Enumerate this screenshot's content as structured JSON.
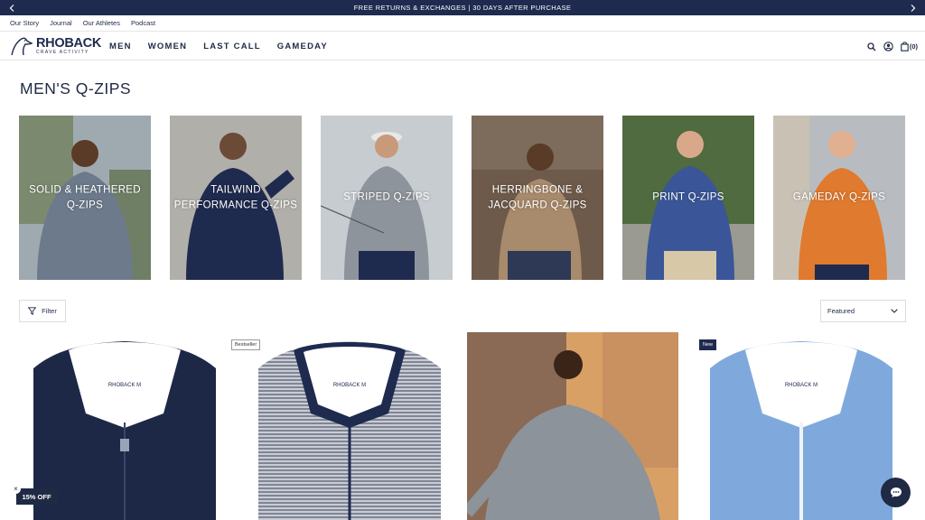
{
  "announcement": {
    "text": "FREE RETURNS & EXCHANGES | 30 DAYS AFTER PURCHASE"
  },
  "utility_links": [
    "Our Story",
    "Journal",
    "Our Athletes",
    "Podcast"
  ],
  "logo": {
    "brand": "RHOBACK",
    "tagline": "CRAVE ACTIVITY"
  },
  "nav": {
    "items": [
      "MEN",
      "WOMEN",
      "LAST CALL",
      "GAMEDAY"
    ]
  },
  "header_icons": {
    "search": "search-icon",
    "account": "account-icon",
    "cart": "cart-icon",
    "cart_count": "(0)"
  },
  "page": {
    "title": "MEN'S Q-ZIPS"
  },
  "categories": [
    {
      "label": "SOLID & HEATHERED Q-ZIPS"
    },
    {
      "label": "TAILWIND PERFORMANCE Q-ZIPS"
    },
    {
      "label": "STRIPED Q-ZIPS"
    },
    {
      "label": "HERRINGBONE & JACQUARD Q-ZIPS"
    },
    {
      "label": "PRINT Q-ZIPS"
    },
    {
      "label": "GAMEDAY Q-ZIPS"
    }
  ],
  "toolbar": {
    "filter_label": "Filter",
    "sort_value": "Featured"
  },
  "products": [
    {
      "badge": "",
      "collar_label": "RHOBACK M"
    },
    {
      "badge": "Bestseller",
      "collar_label": "RHOBACK M"
    },
    {
      "badge": "",
      "collar_label": ""
    },
    {
      "badge": "New",
      "collar_label": "RHOBACK M"
    }
  ],
  "promo": {
    "discount_label": "15% OFF",
    "close_symbol": "×"
  },
  "colors": {
    "navy": "#1f2a4f",
    "text": "#1f2a44",
    "accent_orange": "#e07a2e"
  }
}
